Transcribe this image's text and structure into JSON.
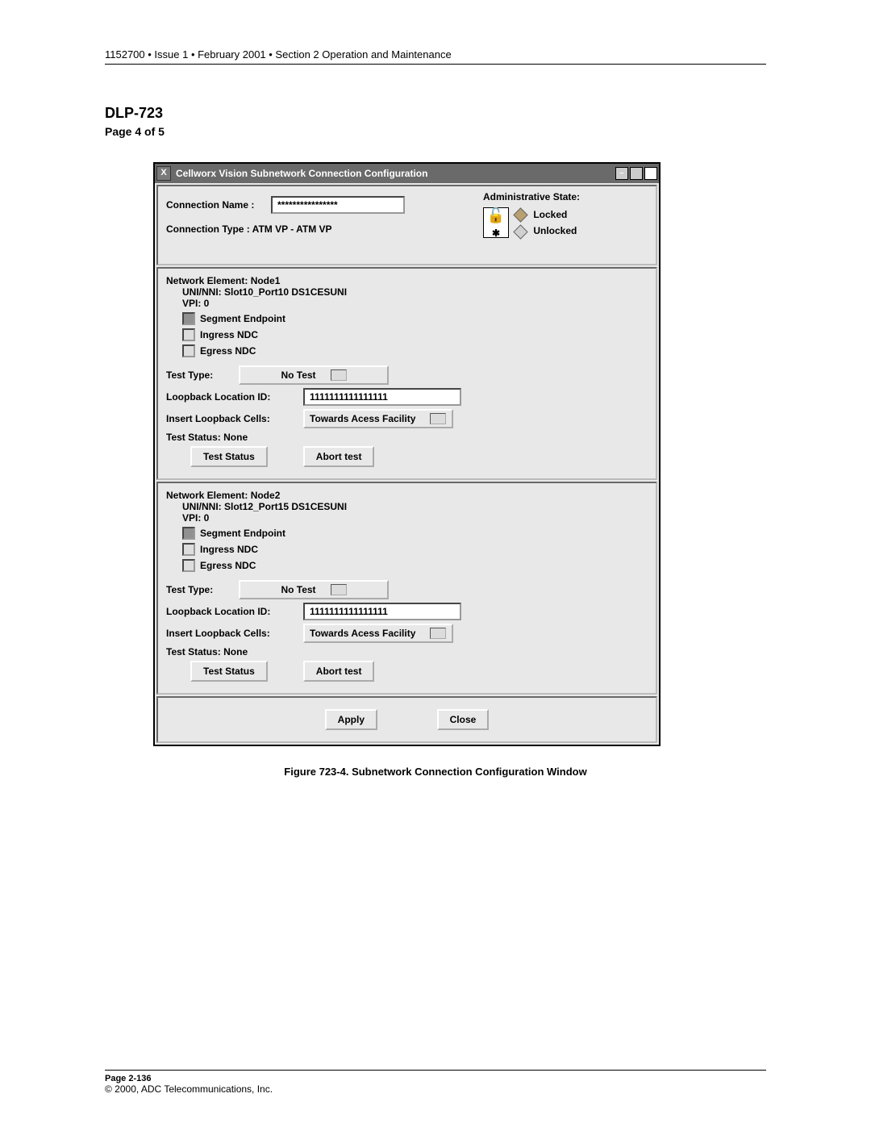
{
  "header": "1152700 • Issue 1 • February 2001 • Section 2 Operation and Maintenance",
  "dlp": "DLP-723",
  "page_of": "Page 4 of 5",
  "window": {
    "title": "Cellworx Vision Subnetwork Connection Configuration",
    "min_btn": "–",
    "max_btn": " ",
    "close_btn": "X",
    "icon_x": "X"
  },
  "top": {
    "conn_name_label": "Connection Name  :",
    "conn_name_value": "****************",
    "conn_type": "Connection Type : ATM VP - ATM VP",
    "admin_state_label": "Administrative State:",
    "locked": "Locked",
    "unlocked": "Unlocked"
  },
  "node1": {
    "ne": "Network Element: Node1",
    "uni": "UNI/NNI:  Slot10_Port10 DS1CESUNI",
    "vpi": "VPI: 0",
    "seg": "Segment Endpoint",
    "ing": "Ingress NDC",
    "egr": "Egress NDC",
    "tt_label": "Test Type:",
    "tt_value": "No Test",
    "loop_label": "Loopback Location ID:",
    "loop_value": "1111111111111111",
    "ins_label": "Insert Loopback Cells:",
    "ins_value": "Towards Acess Facility",
    "ts": "Test Status:  None",
    "btn_status": "Test Status",
    "btn_abort": "Abort test"
  },
  "node2": {
    "ne": "Network Element: Node2",
    "uni": "UNI/NNI:  Slot12_Port15 DS1CESUNI",
    "vpi": "VPI: 0",
    "seg": "Segment Endpoint",
    "ing": "Ingress NDC",
    "egr": "Egress NDC",
    "tt_label": "Test Type:",
    "tt_value": "No Test",
    "loop_label": "Loopback Location ID:",
    "loop_value": "1111111111111111",
    "ins_label": "Insert Loopback Cells:",
    "ins_value": "Towards Acess Facility",
    "ts": "Test Status:  None",
    "btn_status": "Test Status",
    "btn_abort": "Abort test"
  },
  "bottom": {
    "apply": "Apply",
    "close": "Close"
  },
  "caption": "Figure 723-4. Subnetwork Connection Configuration Window",
  "footer": {
    "page": "Page 2-136",
    "copy": "© 2000, ADC Telecommunications, Inc."
  }
}
